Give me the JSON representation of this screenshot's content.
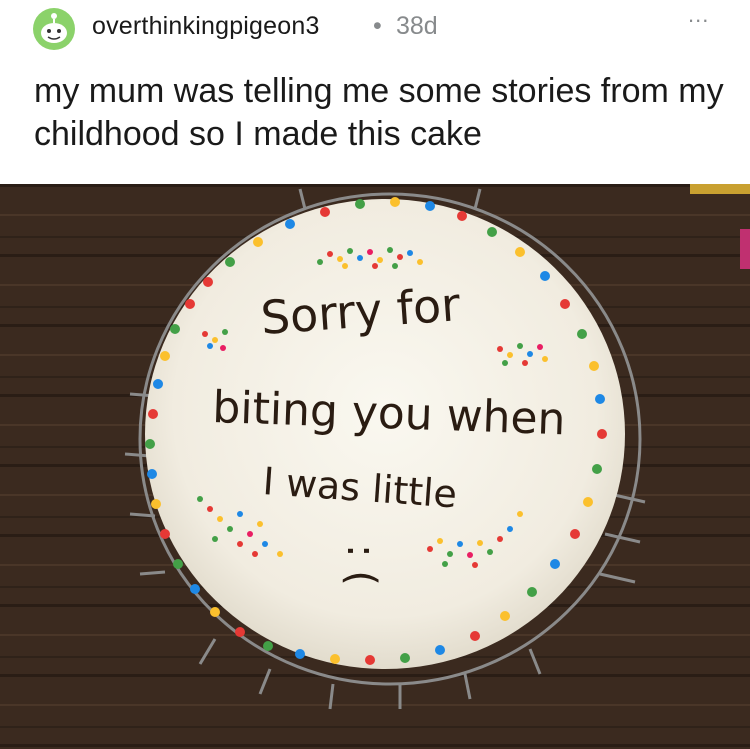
{
  "post": {
    "username": "overthinkingpigeon3",
    "separator": "•",
    "age": "38d",
    "more_label": "...",
    "title": "my mum was telling me some stories from my childhood so I made this cake"
  },
  "image": {
    "cake_lines": [
      "Sorry for",
      "biting you when",
      "I was little"
    ],
    "sad_face": ": ("
  },
  "colors": {
    "avatar": "#8bd26a",
    "table": "#3b2a1f",
    "frosting": "#f3efe4",
    "icing_text": "#2a1c12"
  }
}
